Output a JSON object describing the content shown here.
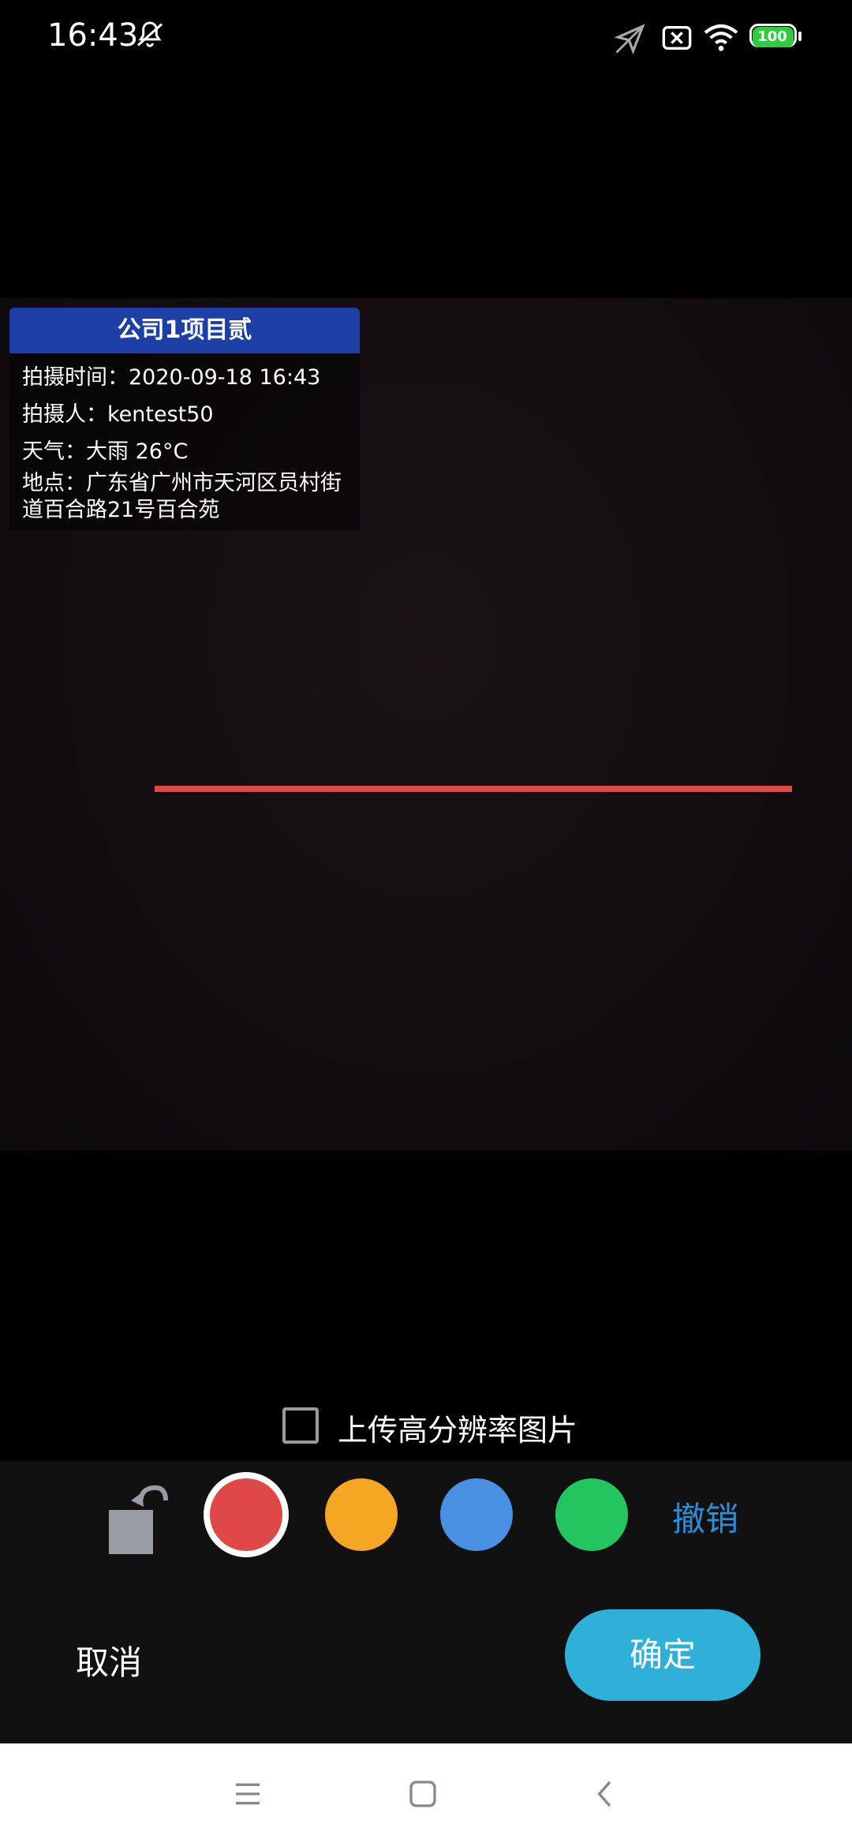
{
  "status_bar": {
    "time": "16:43",
    "battery": "100",
    "icons": [
      "bell-off-icon",
      "send-icon",
      "sim-off-icon",
      "wifi-icon",
      "battery-icon"
    ]
  },
  "watermark": {
    "title": "公司1项目贰",
    "time": "拍摄时间：2020-09-18 16:43",
    "person": "拍摄人：kentest50",
    "weather": "天气：大雨 26°C",
    "location": "地点：广东省广州市天河区员村街道百合路21号百合苑"
  },
  "upload_hd": {
    "label": "上传高分辨率图片",
    "checked": false
  },
  "toolbar": {
    "colors": [
      "#e04848",
      "#f5a623",
      "#4a90e2",
      "#22c55e"
    ],
    "selected_color": "#e04848",
    "undo_label": "撤销"
  },
  "actions": {
    "cancel_label": "取消",
    "confirm_label": "确定"
  },
  "nav_bar": {
    "icons": [
      "menu-icon",
      "home-icon",
      "back-icon"
    ]
  }
}
